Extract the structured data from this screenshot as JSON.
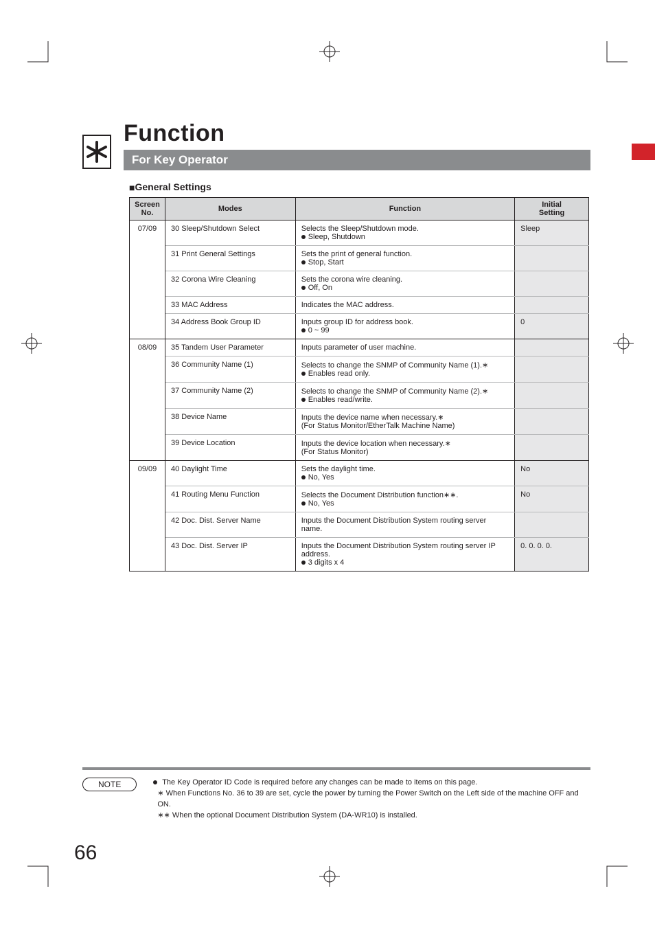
{
  "header": {
    "title": "Function",
    "subtitle": "For Key Operator"
  },
  "section": {
    "title": "General Settings"
  },
  "table": {
    "headers": {
      "screen": "Screen\nNo.",
      "modes": "Modes",
      "function": "Function",
      "initial": "Initial\nSetting"
    },
    "groups": [
      {
        "screen": "07/09",
        "rows": [
          {
            "mode": "30 Sleep/Shutdown Select",
            "funcLines": [
              "Selects the Sleep/Shutdown mode.",
              "● Sleep, Shutdown"
            ],
            "initial": "Sleep"
          },
          {
            "mode": "31  Print General Settings",
            "funcLines": [
              "Sets the print of general function.",
              "● Stop, Start"
            ],
            "initial": ""
          },
          {
            "mode": "32  Corona Wire Cleaning",
            "funcLines": [
              "Sets the corona wire cleaning.",
              "● Off, On"
            ],
            "initial": ""
          },
          {
            "mode": "33  MAC Address",
            "funcLines": [
              "Indicates the MAC address."
            ],
            "initial": ""
          },
          {
            "mode": "34  Address Book Group ID",
            "funcLines": [
              "Inputs group ID for address book.",
              "● 0 ~ 99"
            ],
            "initial": "0"
          }
        ]
      },
      {
        "screen": "08/09",
        "rows": [
          {
            "mode": "35  Tandem User Parameter",
            "funcLines": [
              "Inputs parameter of user machine."
            ],
            "initial": ""
          },
          {
            "mode": "36  Community Name (1)",
            "funcLines": [
              "Selects to change the SNMP of Community Name (1).∗",
              "● Enables read only."
            ],
            "initial": ""
          },
          {
            "mode": "37  Community Name (2)",
            "funcLines": [
              "Selects to change the SNMP of Community Name (2).∗",
              "● Enables read/write."
            ],
            "initial": ""
          },
          {
            "mode": "38  Device Name",
            "funcLines": [
              "Inputs the device name when necessary.∗",
              "(For Status Monitor/EtherTalk Machine Name)"
            ],
            "initial": ""
          },
          {
            "mode": "39  Device Location",
            "funcLines": [
              "Inputs the device location when necessary.∗",
              "(For Status Monitor)"
            ],
            "initial": ""
          }
        ]
      },
      {
        "screen": "09/09",
        "rows": [
          {
            "mode": "40  Daylight Time",
            "funcLines": [
              "Sets the daylight time.",
              "● No, Yes"
            ],
            "initial": "No"
          },
          {
            "mode": "41  Routing Menu Function",
            "funcLines": [
              "Selects the Document Distribution function∗∗.",
              "● No, Yes"
            ],
            "initial": "No"
          },
          {
            "mode": "42  Doc. Dist. Server Name",
            "funcLines": [
              "Inputs the Document Distribution System routing server name."
            ],
            "initial": ""
          },
          {
            "mode": "43  Doc. Dist. Server IP",
            "funcLines": [
              "Inputs the Document Distribution System routing server IP address.",
              "● 3 digits x 4"
            ],
            "initial": "0.  0.  0.  0."
          }
        ]
      }
    ]
  },
  "note": {
    "badge": "NOTE",
    "lines": [
      "● The Key Operator ID Code is required before any changes can be made to items on this page.",
      "∗ When Functions No. 36 to 39 are set, cycle the power by turning the Power Switch on the Left side of the machine OFF and ON.",
      "∗∗ When the optional Document Distribution System (DA-WR10) is installed."
    ]
  },
  "pageNumber": "66"
}
